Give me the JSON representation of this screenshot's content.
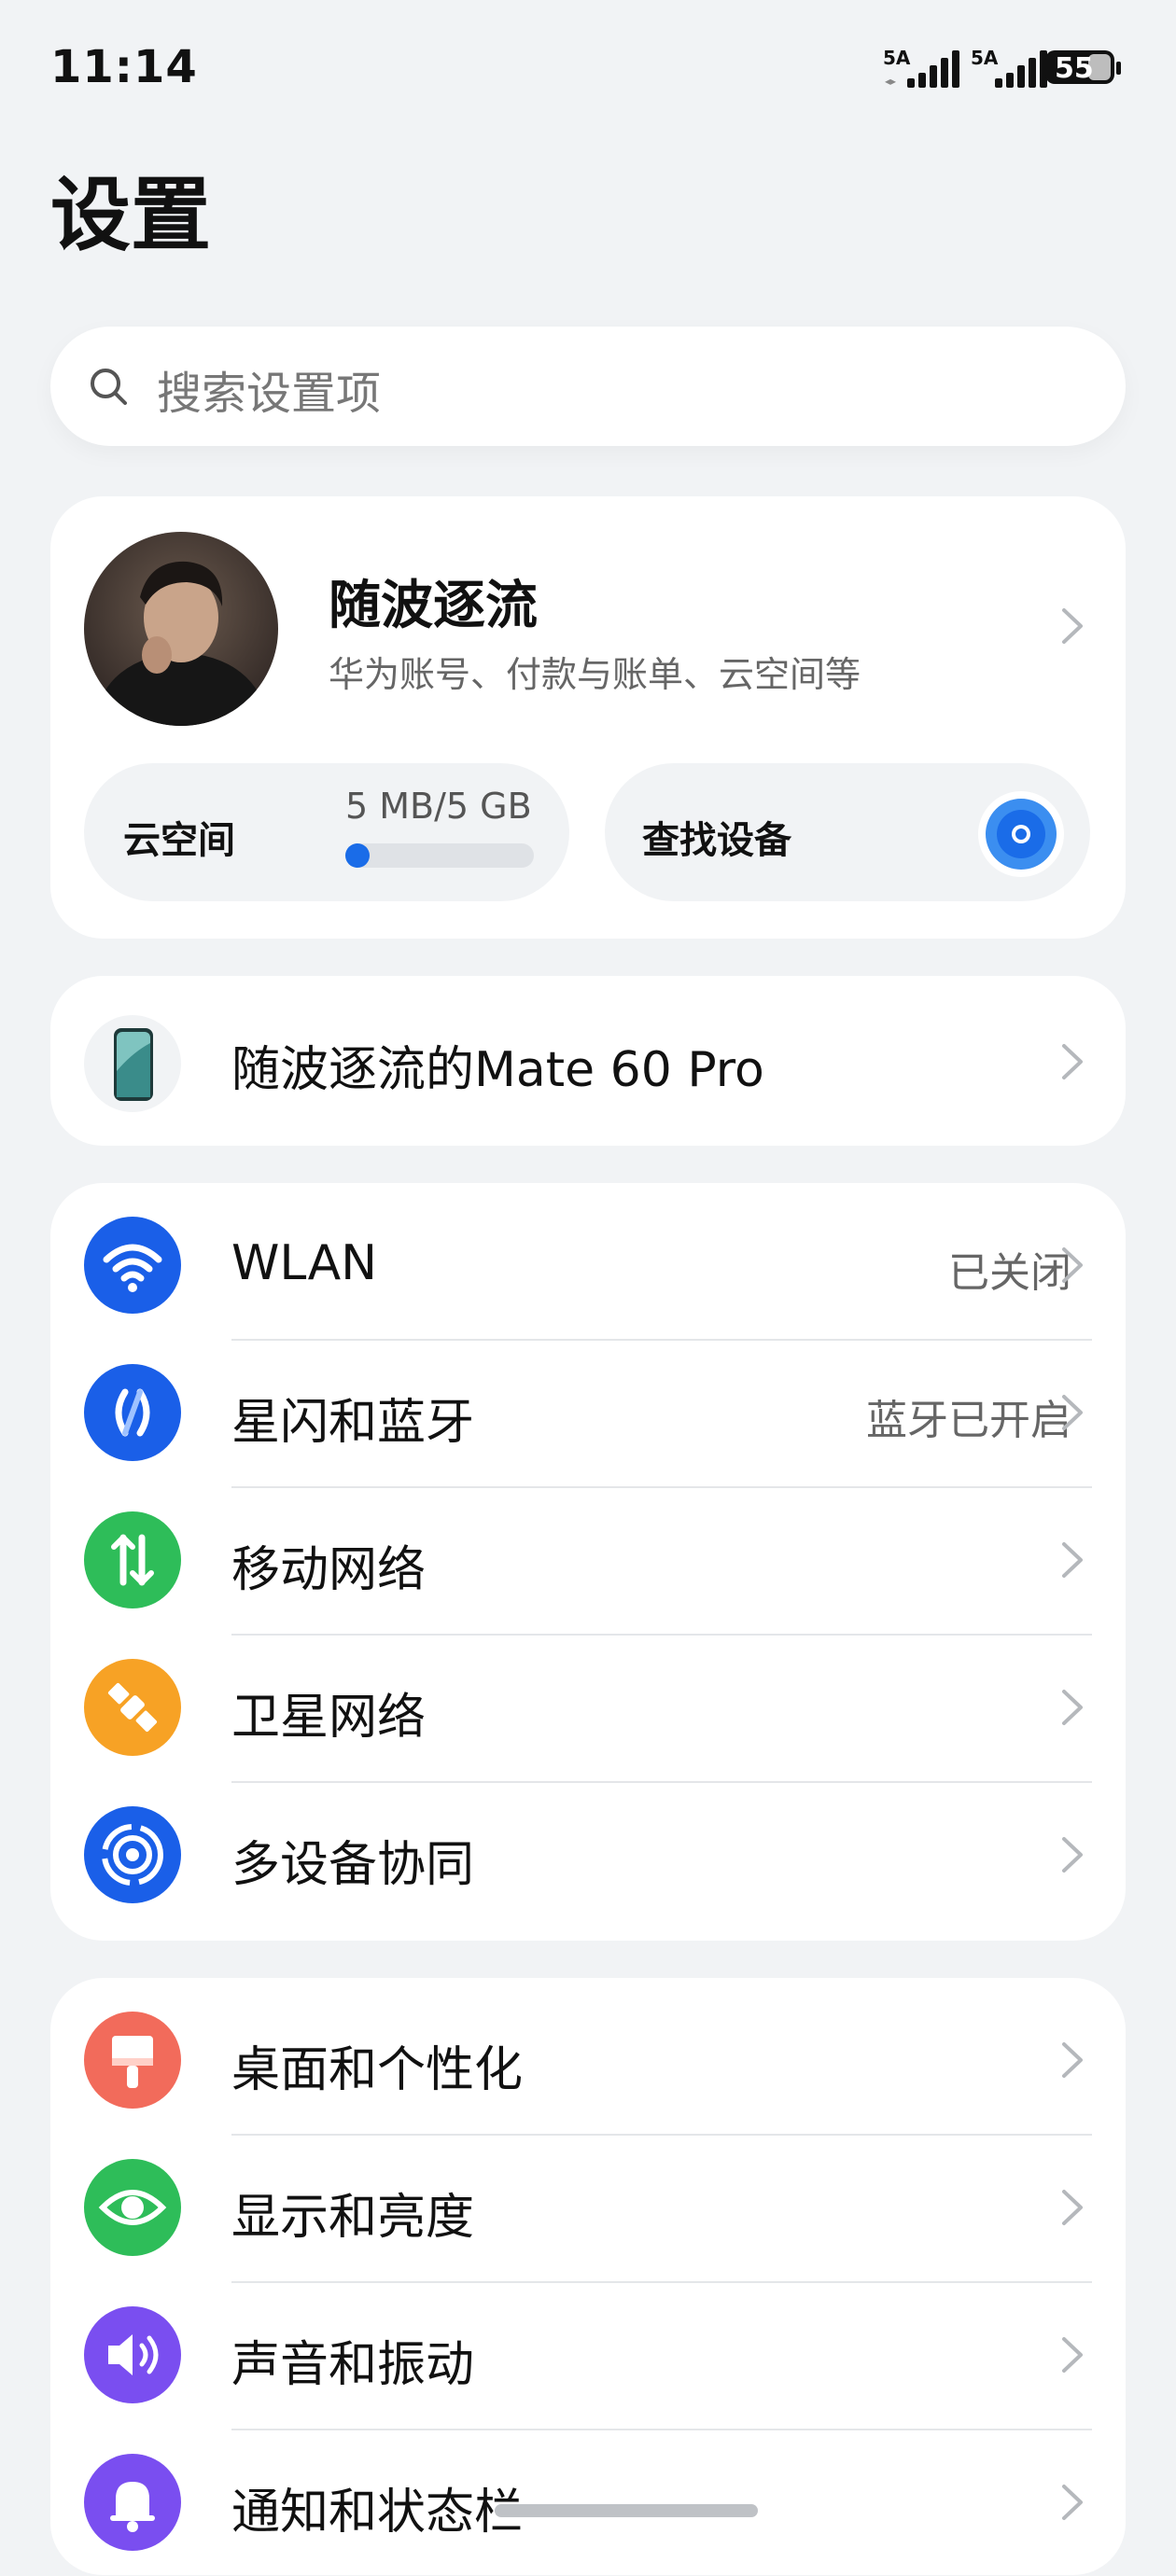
{
  "status_bar": {
    "time": "11:14",
    "sim1_network": "5A",
    "sim2_network": "5A",
    "battery": "55",
    "signal_icon": "signal-bars-icon",
    "battery_icon": "battery-icon"
  },
  "page_title": "设置",
  "search": {
    "placeholder": "搜索设置项",
    "icon": "search-icon"
  },
  "account": {
    "name": "随波逐流",
    "subtitle": "华为账号、付款与账单、云空间等",
    "avatar_icon": "user-avatar"
  },
  "cloud": {
    "label": "云空间",
    "usage": "5 MB/5 GB",
    "usage_fraction": 0.001
  },
  "find_device": {
    "label": "查找设备",
    "icon": "radar-icon"
  },
  "device": {
    "name": "随波逐流的Mate 60 Pro",
    "icon": "phone-icon"
  },
  "groups": [
    [
      {
        "label": "WLAN",
        "value": "已关闭",
        "icon": "wifi-icon",
        "color": "#1a5fe8"
      },
      {
        "label": "星闪和蓝牙",
        "value": "蓝牙已开启",
        "icon": "bluetooth-icon",
        "color": "#1a5fe8"
      },
      {
        "label": "移动网络",
        "value": "",
        "icon": "mobile-data-icon",
        "color": "#2ebd59"
      },
      {
        "label": "卫星网络",
        "value": "",
        "icon": "satellite-icon",
        "color": "#f7a225"
      },
      {
        "label": "多设备协同",
        "value": "",
        "icon": "multi-device-icon",
        "color": "#1a5fe8"
      }
    ],
    [
      {
        "label": "桌面和个性化",
        "value": "",
        "icon": "paint-brush-icon",
        "color": "#f26b5b"
      },
      {
        "label": "显示和亮度",
        "value": "",
        "icon": "eye-icon",
        "color": "#2ebd59"
      },
      {
        "label": "声音和振动",
        "value": "",
        "icon": "speaker-icon",
        "color": "#7a4ef0"
      },
      {
        "label": "通知和状态栏",
        "value": "",
        "icon": "bell-icon",
        "color": "#7a4ef0"
      }
    ]
  ]
}
